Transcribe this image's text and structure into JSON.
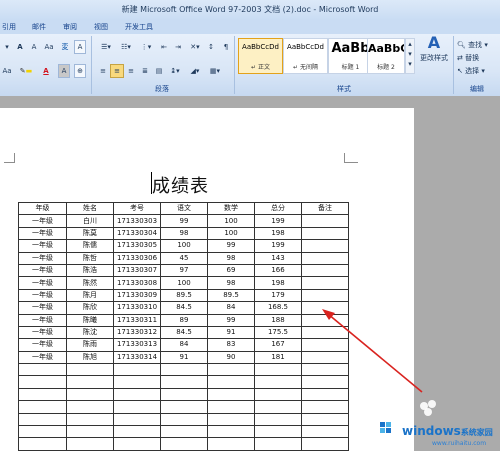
{
  "window": {
    "title": "新建 Microsoft Office Word 97-2003 文档 (2).doc - Microsoft Word"
  },
  "tabs": [
    "引用",
    "邮件",
    "审阅",
    "视图",
    "开发工具"
  ],
  "ribbon": {
    "font_buttons": [
      "A",
      "A",
      "Aa",
      "A",
      "A"
    ],
    "paragraph_label": "段落",
    "styles_label": "样式",
    "editing_label": "编辑",
    "styles": [
      {
        "sample": "AaBbCcDd",
        "name": "↵ 正文"
      },
      {
        "sample": "AaBbCcDd",
        "name": "↵ 无间隔"
      },
      {
        "sample": "AaBb",
        "name": "标题 1"
      },
      {
        "sample": "AaBbC",
        "name": "标题 2"
      }
    ],
    "change_styles": "更改样式",
    "find": "查找",
    "replace": "替换",
    "select": "选择"
  },
  "document": {
    "title": "成绩表",
    "table": {
      "headers": [
        "年级",
        "姓名",
        "考号",
        "语文",
        "数学",
        "总分",
        "备注"
      ],
      "rows": [
        [
          "一年级",
          "白川",
          "171330303",
          "99",
          "100",
          "199",
          ""
        ],
        [
          "一年级",
          "陈莫",
          "171330304",
          "98",
          "100",
          "198",
          ""
        ],
        [
          "一年级",
          "陈儒",
          "171330305",
          "100",
          "99",
          "199",
          ""
        ],
        [
          "一年级",
          "陈哲",
          "171330306",
          "45",
          "98",
          "143",
          ""
        ],
        [
          "一年级",
          "陈浩",
          "171330307",
          "97",
          "69",
          "166",
          ""
        ],
        [
          "一年级",
          "陈然",
          "171330308",
          "100",
          "98",
          "198",
          ""
        ],
        [
          "一年级",
          "陈月",
          "171330309",
          "89.5",
          "89.5",
          "179",
          ""
        ],
        [
          "一年级",
          "陈欣",
          "171330310",
          "84.5",
          "84",
          "168.5",
          ""
        ],
        [
          "一年级",
          "陈曦",
          "171330311",
          "89",
          "99",
          "188",
          ""
        ],
        [
          "一年级",
          "陈沈",
          "171330312",
          "84.5",
          "91",
          "175.5",
          ""
        ],
        [
          "一年级",
          "陈雨",
          "171330313",
          "84",
          "83",
          "167",
          ""
        ],
        [
          "一年级",
          "陈旭",
          "171330314",
          "91",
          "90",
          "181",
          ""
        ]
      ],
      "empty_rows": 7
    }
  },
  "watermark": {
    "brand": "windows",
    "brand_cn": "系统家园",
    "url": "www.ruihaitu.com"
  },
  "colors": {
    "arrow": "#d9231f",
    "ribbon": "#d9e6f6",
    "accent_blue": "#1a73c9"
  }
}
